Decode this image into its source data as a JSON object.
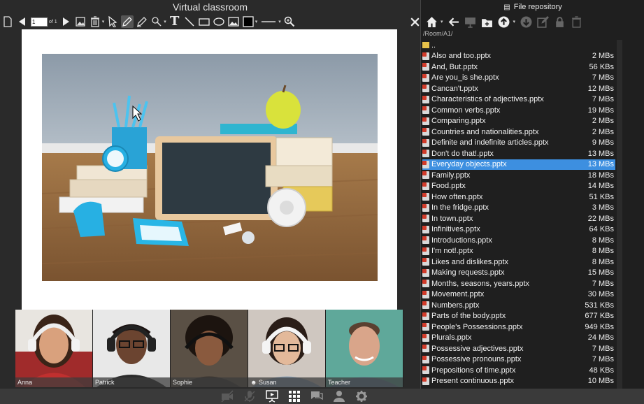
{
  "app": {
    "title": "Virtual classroom"
  },
  "toolbar": {
    "page_current": "1",
    "page_of": "of 1"
  },
  "video": {
    "participants": [
      {
        "name": "Anna",
        "bg": "#a02b2b",
        "skin": "#d9a17d",
        "hair": "#3a2418"
      },
      {
        "name": "Patrick",
        "bg": "#e8e8e8",
        "skin": "#6b4430",
        "hair": "#1a1110"
      },
      {
        "name": "Sophie",
        "bg": "#5a5045",
        "skin": "#8a5a3e",
        "hair": "#1c140f"
      },
      {
        "name": "Susan",
        "bg": "#cfc7c0",
        "skin": "#e3b99a",
        "hair": "#2a1d17",
        "host": true
      },
      {
        "name": "Teacher",
        "bg": "#5fa89a",
        "skin": "#d9a58a",
        "hair": "#5a4030"
      }
    ]
  },
  "repository": {
    "title": "File repository",
    "path": "/Room/A1/",
    "parent": "..",
    "files": [
      {
        "name": "Also and too.pptx",
        "size": "2 MBs"
      },
      {
        "name": "And, But.pptx",
        "size": "56 KBs"
      },
      {
        "name": "Are you_is she.pptx",
        "size": "7 MBs"
      },
      {
        "name": "Cancan't.pptx",
        "size": "12 MBs"
      },
      {
        "name": "Characteristics of adjectives.pptx",
        "size": "7 MBs"
      },
      {
        "name": "Common verbs.pptx",
        "size": "19 MBs"
      },
      {
        "name": "Comparing.pptx",
        "size": "2 MBs"
      },
      {
        "name": "Countries and nationalities.pptx",
        "size": "2 MBs"
      },
      {
        "name": "Definite and indefinite articles.pptx",
        "size": "9 MBs"
      },
      {
        "name": "Don't do that!.pptx",
        "size": "13 MBs"
      },
      {
        "name": "Everyday objects.pptx",
        "size": "13 MBs",
        "selected": true
      },
      {
        "name": "Family.pptx",
        "size": "18 MBs"
      },
      {
        "name": "Food.pptx",
        "size": "14 MBs"
      },
      {
        "name": "How often.pptx",
        "size": "51 KBs"
      },
      {
        "name": "In the fridge.pptx",
        "size": "3 MBs"
      },
      {
        "name": "In town.pptx",
        "size": "22 MBs"
      },
      {
        "name": "Infinitives.pptx",
        "size": "64 KBs"
      },
      {
        "name": "Introductions.pptx",
        "size": "8 MBs"
      },
      {
        "name": "I'm not!.pptx",
        "size": "8 MBs"
      },
      {
        "name": "Likes and dislikes.pptx",
        "size": "8 MBs"
      },
      {
        "name": "Making requests.pptx",
        "size": "15 MBs"
      },
      {
        "name": "Months, seasons, years.pptx",
        "size": "7 MBs"
      },
      {
        "name": "Movement.pptx",
        "size": "30 MBs"
      },
      {
        "name": "Numbers.pptx",
        "size": "531 KBs"
      },
      {
        "name": "Parts of the body.pptx",
        "size": "677 KBs"
      },
      {
        "name": "People's Possessions.pptx",
        "size": "949 KBs"
      },
      {
        "name": "Plurals.pptx",
        "size": "24 MBs"
      },
      {
        "name": "Possessive adjectives.pptx",
        "size": "7 MBs"
      },
      {
        "name": "Possessive pronouns.pptx",
        "size": "7 MBs"
      },
      {
        "name": "Prepositions of time.pptx",
        "size": "48 KBs"
      },
      {
        "name": "Present continuous.pptx",
        "size": "10 MBs"
      }
    ]
  },
  "colors": {
    "selected_row": "#3d8fe0",
    "panel_bg": "#1f1f1f",
    "toolbar_bg": "#2a2a2a"
  }
}
